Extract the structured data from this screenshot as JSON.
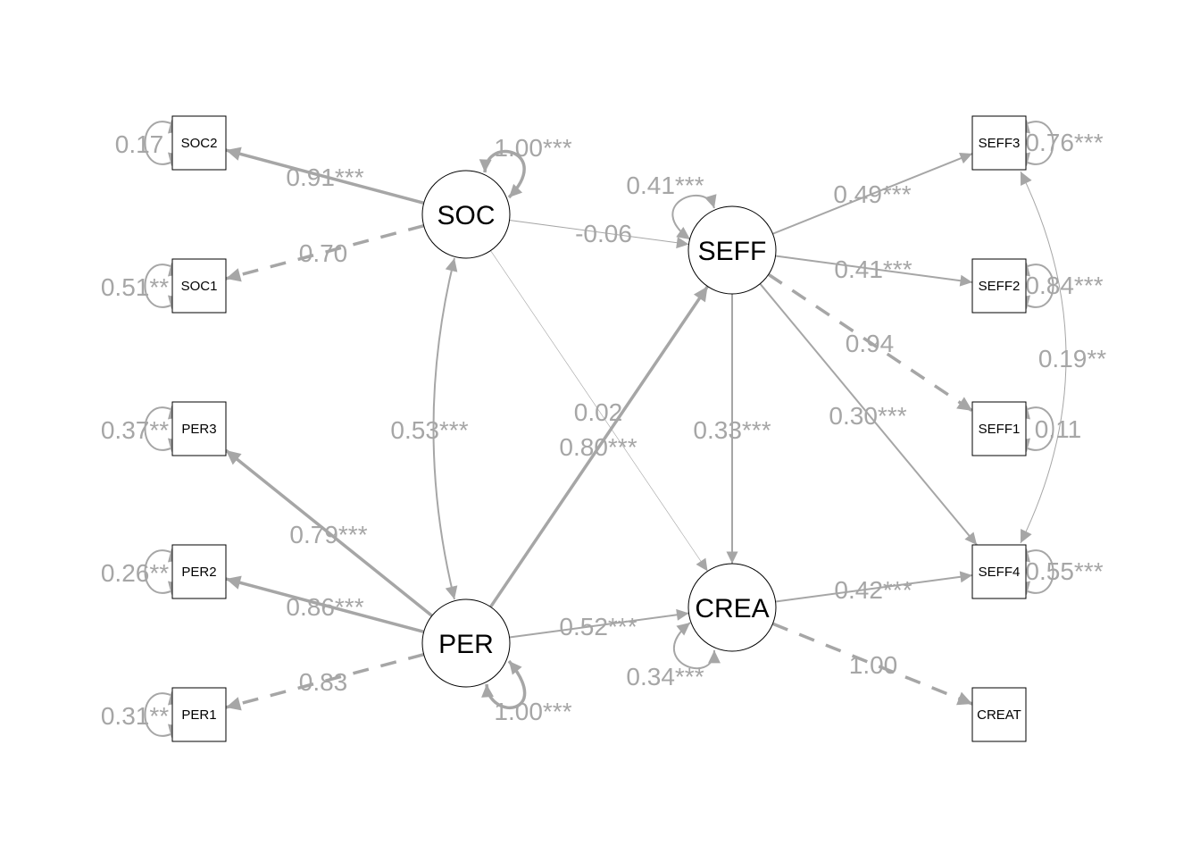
{
  "colors": {
    "edge": "#a6a6a6",
    "label": "#a6a6a6",
    "node_border": "#000000",
    "node_fill": "#ffffff"
  },
  "nodes": {
    "SOC2": {
      "label": "SOC2",
      "type": "observed"
    },
    "SOC1": {
      "label": "SOC1",
      "type": "observed"
    },
    "PER3": {
      "label": "PER3",
      "type": "observed"
    },
    "PER2": {
      "label": "PER2",
      "type": "observed"
    },
    "PER1": {
      "label": "PER1",
      "type": "observed"
    },
    "SEFF3": {
      "label": "SEFF3",
      "type": "observed"
    },
    "SEFF2": {
      "label": "SEFF2",
      "type": "observed"
    },
    "SEFF1": {
      "label": "SEFF1",
      "type": "observed"
    },
    "SEFF4": {
      "label": "SEFF4",
      "type": "observed"
    },
    "CREAT": {
      "label": "CREAT",
      "type": "observed"
    },
    "SOC": {
      "label": "SOC",
      "type": "latent"
    },
    "SEFF": {
      "label": "SEFF",
      "type": "latent"
    },
    "PER": {
      "label": "PER",
      "type": "latent"
    },
    "CREA": {
      "label": "CREA",
      "type": "latent"
    }
  },
  "edges": [
    {
      "from": "SOC",
      "to": "SOC2",
      "label": "0.91***",
      "style": "solid",
      "weight": "thick"
    },
    {
      "from": "SOC",
      "to": "SOC1",
      "label": "0.70",
      "style": "dashed",
      "weight": "thick"
    },
    {
      "from": "PER",
      "to": "PER3",
      "label": "0.79***",
      "style": "solid",
      "weight": "thick"
    },
    {
      "from": "PER",
      "to": "PER2",
      "label": "0.86***",
      "style": "solid",
      "weight": "thick"
    },
    {
      "from": "PER",
      "to": "PER1",
      "label": "0.83",
      "style": "dashed",
      "weight": "thick"
    },
    {
      "from": "SEFF",
      "to": "SEFF3",
      "label": "0.49***",
      "style": "solid",
      "weight": "medium"
    },
    {
      "from": "SEFF",
      "to": "SEFF2",
      "label": "0.41***",
      "style": "solid",
      "weight": "medium"
    },
    {
      "from": "SEFF",
      "to": "SEFF1",
      "label": "0.94",
      "style": "dashed",
      "weight": "thick"
    },
    {
      "from": "CREA",
      "to": "SEFF4",
      "label": "0.42***",
      "style": "solid",
      "weight": "medium"
    },
    {
      "from": "CREA",
      "to": "CREAT",
      "label": "1.00",
      "style": "dashed",
      "weight": "thick"
    },
    {
      "from": "SOC",
      "to": "SEFF",
      "label": "-0.06",
      "style": "solid",
      "weight": "thin"
    },
    {
      "from": "SOC",
      "to": "CREA",
      "label": "0.02",
      "style": "solid",
      "weight": "hair"
    },
    {
      "from": "PER",
      "to": "SEFF",
      "label": "0.80***",
      "style": "solid",
      "weight": "thick"
    },
    {
      "from": "PER",
      "to": "CREA",
      "label": "0.52***",
      "style": "solid",
      "weight": "medium"
    },
    {
      "from": "SEFF",
      "to": "CREA",
      "label": "0.33***",
      "style": "solid",
      "weight": "medium"
    },
    {
      "from": "SEFF",
      "to": "SEFF4",
      "label": "0.30***",
      "style": "solid",
      "weight": "medium"
    },
    {
      "from": "SOC",
      "to": "PER",
      "label": "0.53***",
      "style": "solid",
      "weight": "medium",
      "bidirectional": true
    },
    {
      "from": "SEFF3",
      "to": "SEFF4",
      "label": "0.19**",
      "style": "solid",
      "weight": "thin",
      "bidirectional": true
    }
  ],
  "variances": [
    {
      "node": "SOC2",
      "label": "0.17"
    },
    {
      "node": "SOC1",
      "label": "0.51**"
    },
    {
      "node": "PER3",
      "label": "0.37**"
    },
    {
      "node": "PER2",
      "label": "0.26**"
    },
    {
      "node": "PER1",
      "label": "0.31**"
    },
    {
      "node": "SEFF3",
      "label": "0.76***"
    },
    {
      "node": "SEFF2",
      "label": "0.84***"
    },
    {
      "node": "SEFF1",
      "label": "0.11"
    },
    {
      "node": "SEFF4",
      "label": "0.55***"
    },
    {
      "node": "SOC",
      "label": "1.00***"
    },
    {
      "node": "PER",
      "label": "1.00***"
    },
    {
      "node": "SEFF",
      "label": "0.41***"
    },
    {
      "node": "CREA",
      "label": "0.34***"
    }
  ]
}
